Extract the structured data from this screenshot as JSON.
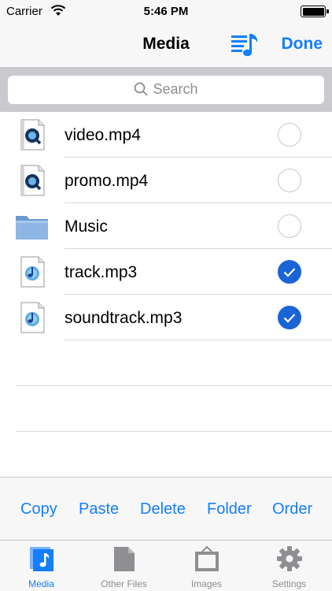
{
  "status_bar": {
    "carrier": "Carrier",
    "time": "5:46 PM"
  },
  "nav": {
    "title": "Media",
    "done_label": "Done",
    "playlist_icon": "playlist-icon"
  },
  "search": {
    "placeholder": "Search"
  },
  "files": [
    {
      "name": "video.mp4",
      "icon": "quicktime-file-icon",
      "selected": false
    },
    {
      "name": "promo.mp4",
      "icon": "quicktime-file-icon",
      "selected": false
    },
    {
      "name": "Music",
      "icon": "folder-icon",
      "selected": false
    },
    {
      "name": "track.mp3",
      "icon": "audio-file-icon",
      "selected": true
    },
    {
      "name": "soundtrack.mp3",
      "icon": "audio-file-icon",
      "selected": true
    }
  ],
  "toolbar": {
    "copy": "Copy",
    "paste": "Paste",
    "delete": "Delete",
    "folder": "Folder",
    "order": "Order"
  },
  "tabs": [
    {
      "label": "Media",
      "icon": "music-note-icon",
      "active": true
    },
    {
      "label": "Other Files",
      "icon": "document-icon",
      "active": false
    },
    {
      "label": "Images",
      "icon": "picture-frame-icon",
      "active": false
    },
    {
      "label": "Settings",
      "icon": "gear-icon",
      "active": false
    }
  ],
  "colors": {
    "accent": "#147efb",
    "check_selected": "#1a64d8",
    "bar_background": "#f7f7f7",
    "search_background": "#c9c9ce"
  }
}
